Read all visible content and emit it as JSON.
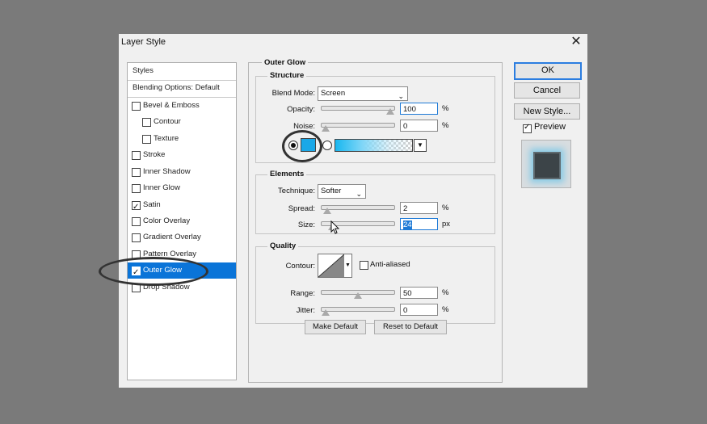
{
  "window": {
    "title": "Layer Style",
    "close_glyph": "✕"
  },
  "styles_list": {
    "items": [
      {
        "label": "Styles",
        "type": "header"
      },
      {
        "label": "Blending Options: Default",
        "type": "header"
      },
      {
        "label": "Bevel & Emboss",
        "checked": false
      },
      {
        "label": "Contour",
        "checked": false,
        "indent": true
      },
      {
        "label": "Texture",
        "checked": false,
        "indent": true
      },
      {
        "label": "Stroke",
        "checked": false
      },
      {
        "label": "Inner Shadow",
        "checked": false
      },
      {
        "label": "Inner Glow",
        "checked": false
      },
      {
        "label": "Satin",
        "checked": true
      },
      {
        "label": "Color Overlay",
        "checked": false
      },
      {
        "label": "Gradient Overlay",
        "checked": false
      },
      {
        "label": "Pattern Overlay",
        "checked": false
      },
      {
        "label": "Outer Glow",
        "checked": true,
        "selected": true
      },
      {
        "label": "Drop Shadow",
        "checked": false
      }
    ]
  },
  "outer_glow": {
    "title": "Outer Glow",
    "structure": {
      "title": "Structure",
      "blend_mode_label": "Blend Mode:",
      "blend_mode_value": "Screen",
      "opacity_label": "Opacity:",
      "opacity_value": "100",
      "opacity_unit": "%",
      "opacity_level": 1.0,
      "noise_label": "Noise:",
      "noise_value": "0",
      "noise_unit": "%",
      "noise_level": 0.0,
      "glow_color": "#1aa8e8"
    },
    "elements": {
      "title": "Elements",
      "technique_label": "Technique:",
      "technique_value": "Softer",
      "spread_label": "Spread:",
      "spread_value": "2",
      "spread_unit": "%",
      "spread_level": 0.02,
      "size_label": "Size:",
      "size_value": "24",
      "size_unit": "px",
      "size_level": 0.1
    },
    "quality": {
      "title": "Quality",
      "contour_label": "Contour:",
      "anti_aliased_label": "Anti-aliased",
      "anti_aliased_checked": false,
      "range_label": "Range:",
      "range_value": "50",
      "range_unit": "%",
      "range_level": 0.5,
      "jitter_label": "Jitter:",
      "jitter_value": "0",
      "jitter_unit": "%",
      "jitter_level": 0.0
    },
    "make_default_label": "Make Default",
    "reset_default_label": "Reset to Default"
  },
  "buttons": {
    "ok": "OK",
    "cancel": "Cancel",
    "new_style": "New Style..."
  },
  "preview": {
    "label": "Preview",
    "checked": true
  },
  "colors": {
    "selection": "#0a74d8",
    "accent": "#2b7de0",
    "glow": "#1aa8e8"
  }
}
